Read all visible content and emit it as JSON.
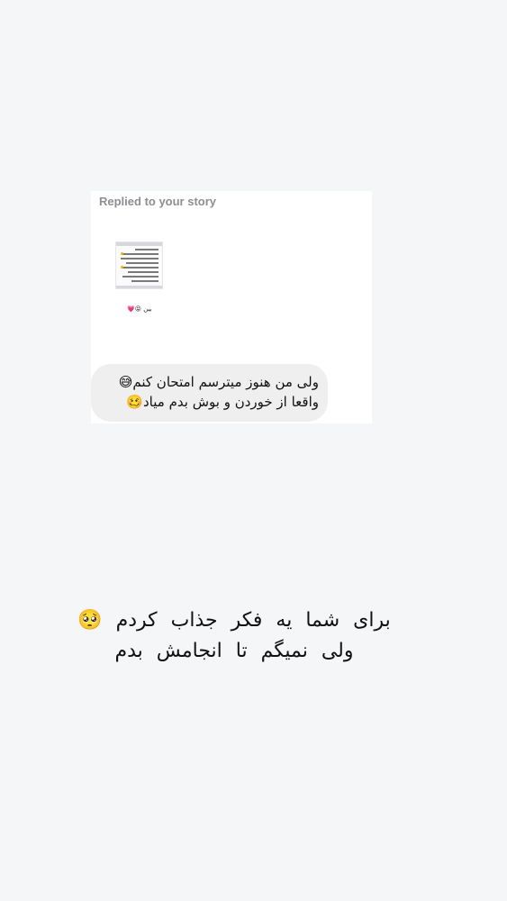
{
  "story_reply": {
    "label": "Replied to your story",
    "story_caption": "بین 😝💗",
    "message_lines": [
      "ولی من هنوز میترسم امتحان کنم😅",
      "واقعا از خوردن و بوش بدم میاد🥴"
    ]
  },
  "overlay_text": {
    "lines": [
      "برای شما یه فکر جذاب کردم 🥺",
      "ولی نمیگم تا انجامش بدم"
    ]
  },
  "colors": {
    "background": "#f5f6f8",
    "card": "#ffffff",
    "bubble": "#efefef",
    "label": "#8e8e93"
  }
}
